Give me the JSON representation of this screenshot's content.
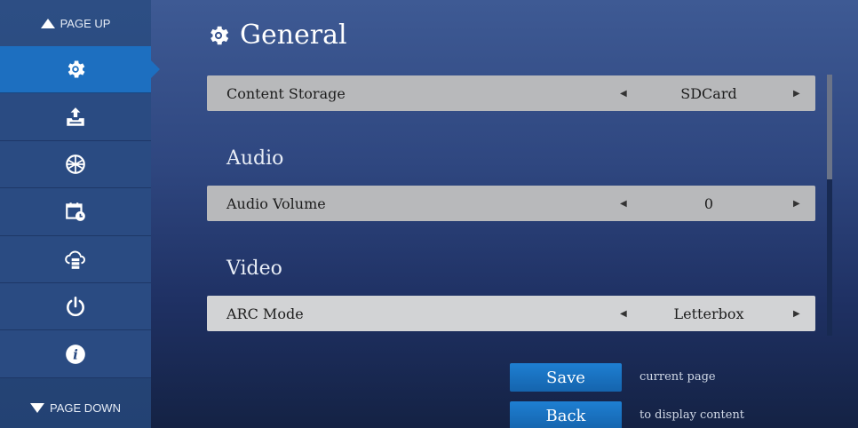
{
  "sidebar": {
    "page_up_label": "PAGE UP",
    "page_down_label": "PAGE DOWN",
    "items": [
      {
        "icon": "gear-icon",
        "active": true
      },
      {
        "icon": "upload-tray-icon",
        "active": false
      },
      {
        "icon": "globe-icon",
        "active": false
      },
      {
        "icon": "calendar-clock-icon",
        "active": false
      },
      {
        "icon": "cloud-server-icon",
        "active": false
      },
      {
        "icon": "power-icon",
        "active": false
      },
      {
        "icon": "info-icon",
        "active": false
      }
    ]
  },
  "header": {
    "title": "General",
    "icon": "gear-icon"
  },
  "rows": {
    "content_storage": {
      "label": "Content Storage",
      "value": "SDCard"
    },
    "audio_volume": {
      "label": "Audio Volume",
      "value": "0"
    },
    "arc_mode": {
      "label": "ARC Mode",
      "value": "Letterbox"
    }
  },
  "sections": {
    "audio": "Audio",
    "video": "Video"
  },
  "footer": {
    "save_label": "Save",
    "save_desc": "current page",
    "back_label": "Back",
    "back_desc": "to display content"
  },
  "colors": {
    "accent": "#1d6fc0",
    "sidebar": "#2a4b82",
    "row": "#b8b9bb",
    "row_highlight": "#d2d3d5"
  }
}
